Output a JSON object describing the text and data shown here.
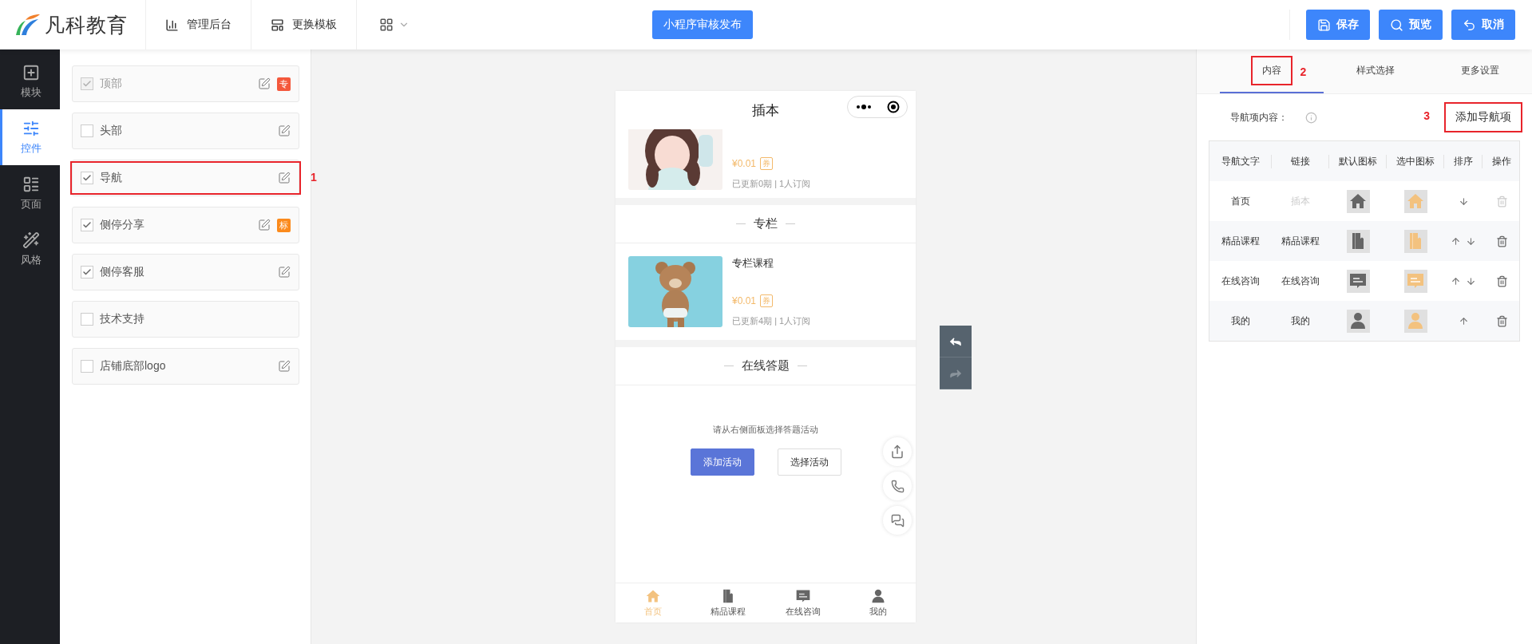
{
  "header": {
    "logo": "凡科教育",
    "nav": [
      {
        "label": "管理后台"
      },
      {
        "label": "更换模板"
      }
    ],
    "publish_button": "小程序审核发布",
    "actions": [
      {
        "label": "保存"
      },
      {
        "label": "预览"
      },
      {
        "label": "取消"
      }
    ]
  },
  "sidebar": {
    "items": [
      {
        "label": "模块",
        "selected": false
      },
      {
        "label": "控件",
        "selected": true
      },
      {
        "label": "页面",
        "selected": false
      },
      {
        "label": "风格",
        "selected": false
      }
    ]
  },
  "controls": [
    {
      "label": "顶部",
      "checked": true,
      "disabled": true,
      "editable": true,
      "badge": {
        "text": "专",
        "color": "#f4583c"
      }
    },
    {
      "label": "头部",
      "checked": false,
      "disabled": false,
      "editable": true
    },
    {
      "label": "导航",
      "checked": true,
      "disabled": false,
      "editable": true,
      "annotation": "1"
    },
    {
      "label": "侧停分享",
      "checked": true,
      "disabled": false,
      "editable": true,
      "badge": {
        "text": "标",
        "color": "#fb8a1c"
      }
    },
    {
      "label": "侧停客服",
      "checked": true,
      "disabled": false,
      "editable": true
    },
    {
      "label": "技术支持",
      "checked": false,
      "disabled": false,
      "editable": false
    },
    {
      "label": "店铺底部logo",
      "checked": false,
      "disabled": false,
      "editable": true
    }
  ],
  "preview": {
    "title": "插本",
    "blocks": [
      {
        "kind": "list",
        "items": [
          {
            "cut": true,
            "price": "¥0.01",
            "coupon": "券",
            "meta": "已更新0期 | 1人订阅"
          }
        ]
      },
      {
        "kind": "column",
        "heading": "专栏",
        "items": [
          {
            "cut": false,
            "title": "专栏课程",
            "price": "¥0.01",
            "coupon": "券",
            "meta": "已更新4期 | 1人订阅"
          }
        ]
      },
      {
        "kind": "quiz",
        "heading": "在线答题",
        "prompt": "请从右侧面板选择答题活动",
        "primary": "添加活动",
        "secondary": "选择活动"
      }
    ],
    "tabbar": [
      {
        "label": "首页",
        "selected": true
      },
      {
        "label": "精品课程",
        "selected": false
      },
      {
        "label": "在线咨询",
        "selected": false
      },
      {
        "label": "我的",
        "selected": false
      }
    ]
  },
  "history": {
    "undo_enabled": true,
    "redo_enabled": false
  },
  "panel": {
    "tabs": [
      {
        "label": "内容",
        "selected": true,
        "annotation": "2"
      },
      {
        "label": "样式选择",
        "selected": false
      },
      {
        "label": "更多设置",
        "selected": false
      }
    ],
    "field_label": "导航项内容：",
    "add_button": {
      "label": "添加导航项",
      "annotation": "3"
    },
    "table": {
      "columns": [
        "导航文字",
        "链接",
        "默认图标",
        "选中图标",
        "排序",
        "操作"
      ],
      "rows": [
        {
          "text": "首页",
          "link": "插本",
          "link_muted": true,
          "move_up": false,
          "move_down": true,
          "deletable": false
        },
        {
          "text": "精品课程",
          "link": "精品课程",
          "link_muted": false,
          "move_up": true,
          "move_down": true,
          "deletable": true
        },
        {
          "text": "在线咨询",
          "link": "在线咨询",
          "link_muted": false,
          "move_up": true,
          "move_down": true,
          "deletable": true
        },
        {
          "text": "我的",
          "link": "我的",
          "link_muted": false,
          "move_up": true,
          "move_down": false,
          "deletable": true
        }
      ]
    }
  }
}
